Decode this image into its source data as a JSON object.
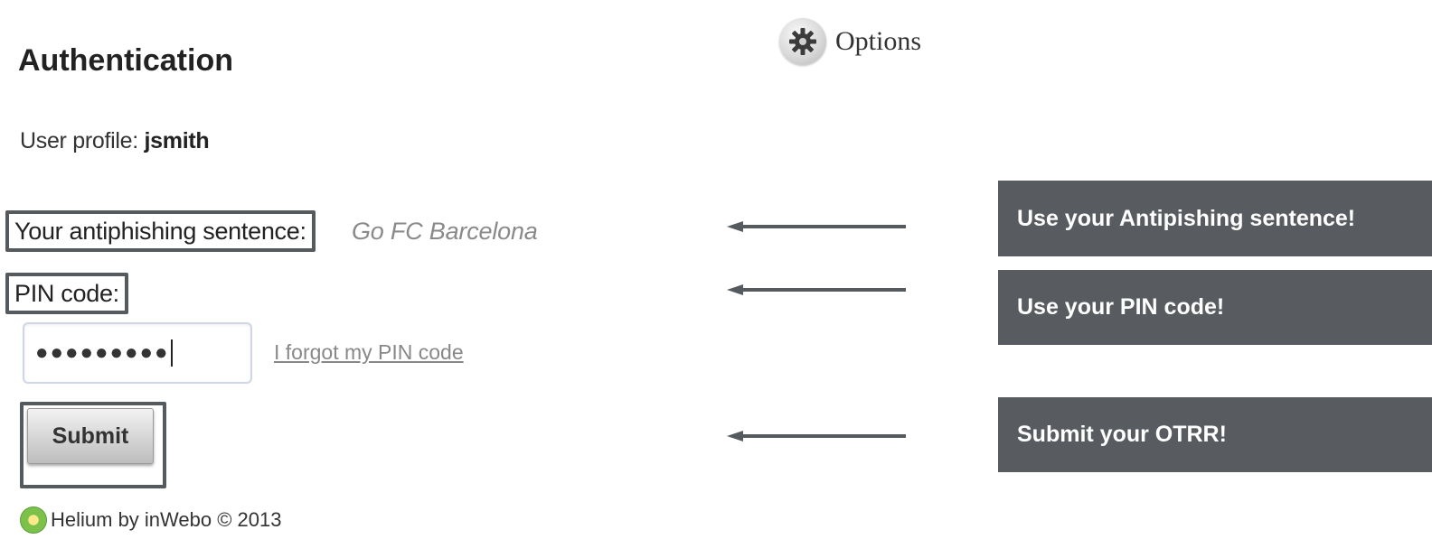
{
  "header": {
    "options_label": "Options",
    "options_icon": "gear-icon"
  },
  "auth": {
    "title": "Authentication",
    "profile_label": "User profile:",
    "profile_user": "jsmith",
    "antiphishing_label": "Your antiphishing sentence:",
    "antiphishing_value": "Go FC Barcelona",
    "pin_label": "PIN code:",
    "pin_value": "●●●●●●●●●",
    "forgot_link": "I forgot my PIN code",
    "submit_label": "Submit"
  },
  "footer": {
    "text": "Helium by inWebo © 2013",
    "logo_icon": "helium-logo-icon"
  },
  "callouts": [
    {
      "text": "Use your Antipishing sentence!"
    },
    {
      "text": "Use your PIN code!"
    },
    {
      "text": "Submit your OTRR!"
    }
  ],
  "colors": {
    "callout_bg": "#585b5f",
    "highlight_border": "#555a5f",
    "arrow": "#555a5f"
  }
}
